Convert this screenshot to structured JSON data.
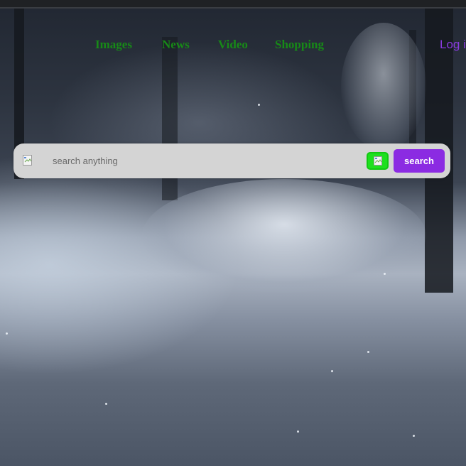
{
  "nav": {
    "links": [
      {
        "label": "Images"
      },
      {
        "label": "News"
      },
      {
        "label": "Video"
      },
      {
        "label": "Shopping"
      }
    ],
    "login_label": "Log in"
  },
  "search": {
    "placeholder": "search anything",
    "value": "",
    "button_label": "search",
    "voice_icon": "broken-image-icon",
    "leading_icon": "broken-image-icon"
  },
  "colors": {
    "nav_link": "#178a17",
    "login": "#8a3be0",
    "search_button": "#8b2be2",
    "voice_button": "#1ee01e",
    "search_bar": "#d4d4d4"
  }
}
